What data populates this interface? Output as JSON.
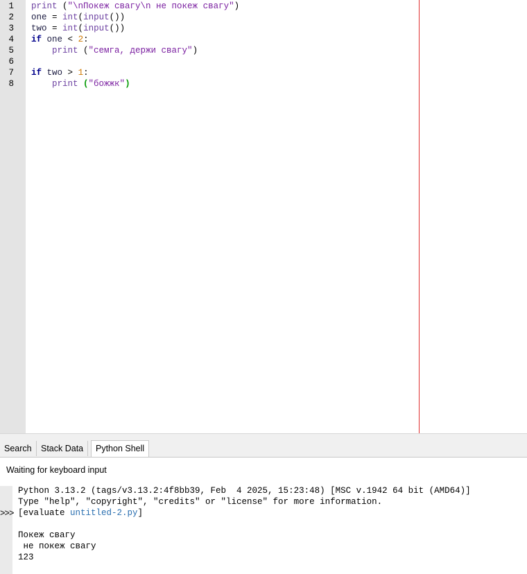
{
  "editor": {
    "line_numbers": [
      "1",
      "2",
      "3",
      "4",
      "5",
      "6",
      "7",
      "8"
    ],
    "lines": [
      {
        "tokens": [
          {
            "t": "print",
            "c": "fn"
          },
          {
            "t": " (",
            "c": "par"
          },
          {
            "t": "\"\\nПокеж свагу\\n не покеж свагу\"",
            "c": "str"
          },
          {
            "t": ")",
            "c": "par"
          }
        ]
      },
      {
        "tokens": [
          {
            "t": "one",
            "c": "id"
          },
          {
            "t": " = ",
            "c": "op"
          },
          {
            "t": "int",
            "c": "fn"
          },
          {
            "t": "(",
            "c": "par"
          },
          {
            "t": "input",
            "c": "fn"
          },
          {
            "t": "())",
            "c": "par"
          }
        ]
      },
      {
        "tokens": [
          {
            "t": "two",
            "c": "id"
          },
          {
            "t": " = ",
            "c": "op"
          },
          {
            "t": "int",
            "c": "fn"
          },
          {
            "t": "(",
            "c": "par"
          },
          {
            "t": "input",
            "c": "fn"
          },
          {
            "t": "())",
            "c": "par"
          }
        ]
      },
      {
        "tokens": [
          {
            "t": "if",
            "c": "kw"
          },
          {
            "t": " one ",
            "c": "id"
          },
          {
            "t": "<",
            "c": "op"
          },
          {
            "t": " ",
            "c": "id"
          },
          {
            "t": "2",
            "c": "num"
          },
          {
            "t": ":",
            "c": "op"
          }
        ]
      },
      {
        "tokens": [
          {
            "t": "    print",
            "c": "fn"
          },
          {
            "t": " (",
            "c": "par"
          },
          {
            "t": "\"семга, держи свагу\"",
            "c": "str"
          },
          {
            "t": ")",
            "c": "par"
          }
        ]
      },
      {
        "tokens": []
      },
      {
        "tokens": [
          {
            "t": "if",
            "c": "kw"
          },
          {
            "t": " two ",
            "c": "id"
          },
          {
            "t": ">",
            "c": "op"
          },
          {
            "t": " ",
            "c": "id"
          },
          {
            "t": "1",
            "c": "num"
          },
          {
            "t": ":",
            "c": "op"
          }
        ]
      },
      {
        "tokens": [
          {
            "t": "    print",
            "c": "fn"
          },
          {
            "t": " ",
            "c": "id"
          },
          {
            "t": "(",
            "c": "par-match"
          },
          {
            "t": "\"божжк\"",
            "c": "str"
          },
          {
            "t": ")",
            "c": "par-match"
          }
        ]
      }
    ]
  },
  "tabs": [
    {
      "label": "Search",
      "active": false
    },
    {
      "label": "Stack Data",
      "active": false
    },
    {
      "label": "Python Shell",
      "active": true
    }
  ],
  "shell": {
    "status": "Waiting for keyboard input",
    "prompt": ">>>",
    "banner1": "Python 3.13.2 (tags/v3.13.2:4f8bb39, Feb  4 2025, 15:23:48) [MSC v.1942 64 bit (AMD64)]",
    "banner2": "Type \"help\", \"copyright\", \"credits\" or \"license\" for more information.",
    "eval_prefix": "[evaluate ",
    "eval_file": "untitled-2.py",
    "eval_suffix": "]",
    "output": [
      "",
      "Покеж свагу",
      " не покеж свагу",
      "123"
    ]
  },
  "colors": {
    "edge_line": "#e03030",
    "gutter": "#e4e4e4",
    "keyword": "#00008b",
    "string": "#7a1fa0",
    "number": "#d07800",
    "bracket_match": "#009900"
  }
}
